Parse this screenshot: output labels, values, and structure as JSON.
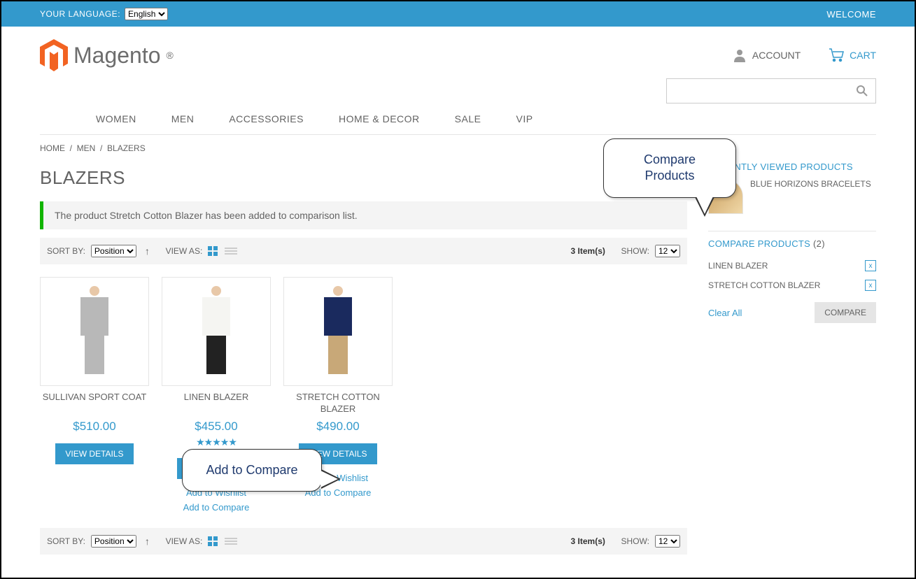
{
  "topbar": {
    "langLabel": "YOUR LANGUAGE:",
    "langValue": "English",
    "welcome": "WELCOME"
  },
  "header": {
    "logoText": "Magento",
    "account": "ACCOUNT",
    "cart": "CART"
  },
  "nav": [
    "WOMEN",
    "MEN",
    "ACCESSORIES",
    "HOME & DECOR",
    "SALE",
    "VIP"
  ],
  "breadcrumbs": [
    "HOME",
    "MEN",
    "BLAZERS"
  ],
  "pageTitle": "BLAZERS",
  "message": "The product Stretch Cotton Blazer has been added to comparison list.",
  "toolbar": {
    "sortByLabel": "SORT BY:",
    "sortByValue": "Position",
    "viewAsLabel": "VIEW AS:",
    "itemCount": "3 Item(s)",
    "showLabel": "SHOW:",
    "showValue": "12"
  },
  "products": [
    {
      "name": "SULLIVAN SPORT COAT",
      "price": "$510.00",
      "stars": "",
      "btn": "VIEW DETAILS",
      "wishlist": "",
      "compare": "",
      "torso": "#b8b8b8",
      "legs": "#b8b8b8"
    },
    {
      "name": "LINEN BLAZER",
      "price": "$455.00",
      "stars": "★★★★★",
      "btn": "VIEW DETAILS",
      "wishlist": "Add to Wishlist",
      "compare": "Add to Compare",
      "torso": "#f5f5f2",
      "legs": "#222"
    },
    {
      "name": "STRETCH COTTON BLAZER",
      "price": "$490.00",
      "stars": "",
      "btn": "VIEW DETAILS",
      "wishlist": "Add to Wishlist",
      "compare": "Add to Compare",
      "torso": "#1a2a5e",
      "legs": "#c8a878"
    }
  ],
  "sidebar": {
    "recentlyViewed": {
      "title": "RECENTLY VIEWED PRODUCTS",
      "item": "BLUE HORIZONS BRACELETS"
    },
    "compare": {
      "title": "COMPARE PRODUCTS",
      "count": "(2)",
      "items": [
        "LINEN BLAZER",
        "STRETCH COTTON BLAZER"
      ],
      "clear": "Clear All",
      "compareBtn": "COMPARE"
    }
  },
  "callouts": {
    "compareProducts": "Compare Products",
    "addCompare": "Add to Compare"
  }
}
